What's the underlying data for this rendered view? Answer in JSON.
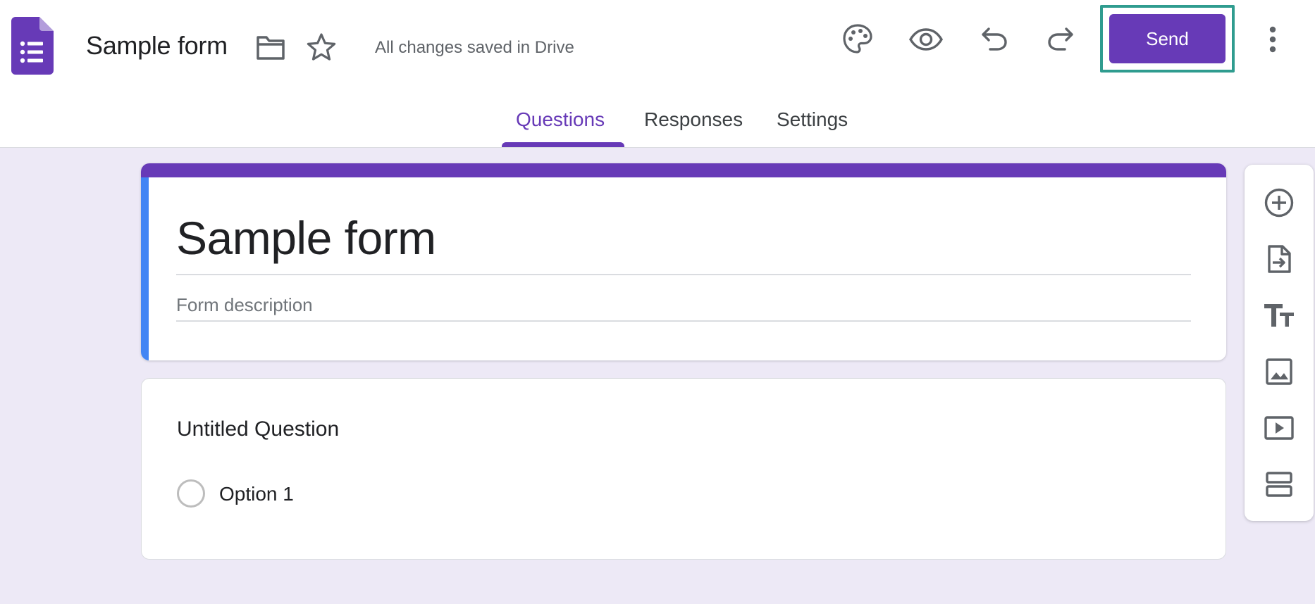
{
  "header": {
    "form_title": "Sample form",
    "save_status": "All changes saved in Drive",
    "send_label": "Send"
  },
  "tabs": [
    {
      "label": "Questions",
      "active": true
    },
    {
      "label": "Responses",
      "active": false
    },
    {
      "label": "Settings",
      "active": false
    }
  ],
  "form": {
    "title": "Sample form",
    "description_placeholder": "Form description"
  },
  "question": {
    "title": "Untitled Question",
    "options": [
      {
        "label": "Option 1"
      }
    ]
  },
  "toolbar_icons": [
    "add-question-icon",
    "import-questions-icon",
    "add-title-description-icon",
    "add-image-icon",
    "add-video-icon",
    "add-section-icon"
  ],
  "colors": {
    "accent": "#673ab7",
    "title_left_bar": "#4285f4",
    "background": "#ede9f6",
    "highlight_border": "#2f9c8f"
  }
}
